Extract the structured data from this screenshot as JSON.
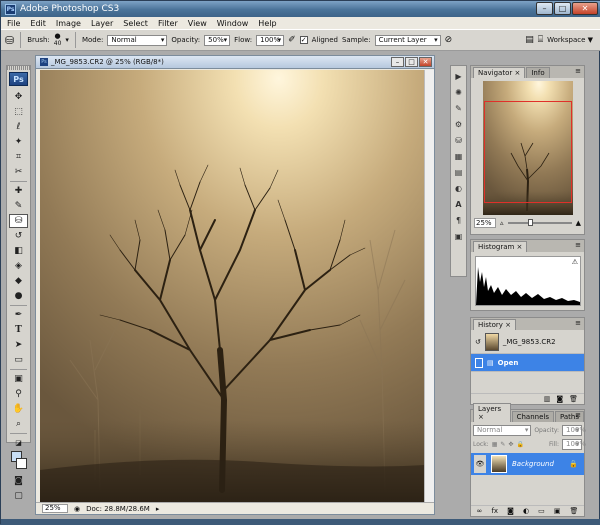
{
  "app": {
    "title": "Adobe Photoshop CS3",
    "logo": "Ps"
  },
  "menu": [
    "File",
    "Edit",
    "Image",
    "Layer",
    "Select",
    "Filter",
    "View",
    "Window",
    "Help"
  ],
  "options": {
    "brush_label": "Brush:",
    "brush_size": "40",
    "mode_label": "Mode:",
    "mode_value": "Normal",
    "opacity_label": "Opacity:",
    "opacity_value": "50%",
    "flow_label": "Flow:",
    "flow_value": "100%",
    "aligned_label": "Aligned",
    "sample_label": "Sample:",
    "sample_value": "Current Layer",
    "workspace_label": "Workspace ▼"
  },
  "document": {
    "title": "_MG_9853.CR2 @ 25% (RGB/8*)",
    "zoom": "25%",
    "doc_info": "Doc: 28.8M/28.6M"
  },
  "navigator": {
    "tab_navigator": "Navigator",
    "tab_info": "Info",
    "zoom": "25%"
  },
  "histogram": {
    "tab": "Histogram"
  },
  "history": {
    "tab": "History",
    "snapshot": "_MG_9853.CR2",
    "step": "Open"
  },
  "layers": {
    "tab_layers": "Layers",
    "tab_channels": "Channels",
    "tab_paths": "Paths",
    "blend_mode": "Normal",
    "opacity_label": "Opacity:",
    "opacity_value": "100%",
    "lock_label": "Lock:",
    "fill_label": "Fill:",
    "fill_value": "100%",
    "layer_name": "Background"
  },
  "colors": {
    "selection": "#3d83e6",
    "title_bar": "#4a7399"
  }
}
